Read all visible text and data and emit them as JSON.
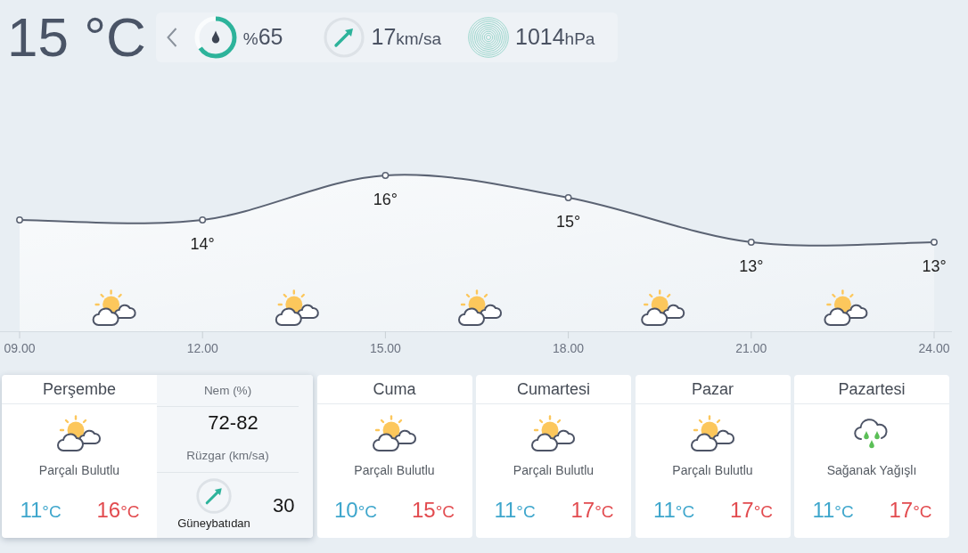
{
  "current": {
    "temperature": "15 °C",
    "humidity": {
      "unit": "%",
      "value": "65",
      "level": 0.65
    },
    "wind": {
      "value": "17",
      "unit": "km/sa"
    },
    "pressure": {
      "value": "1014",
      "unit": "hPa"
    }
  },
  "hourly": {
    "chart_data": {
      "type": "area",
      "categories": [
        "09.00",
        "12.00",
        "15.00",
        "18.00",
        "21.00",
        "24.00"
      ],
      "values": [
        14,
        14,
        16,
        15,
        13,
        13
      ],
      "value_labels": [
        null,
        "14°",
        "16°",
        "15°",
        "13°",
        "13°"
      ]
    },
    "conditions": [
      {
        "kind": "partly_cloudy"
      },
      {
        "kind": "partly_cloudy"
      },
      {
        "kind": "partly_cloudy"
      },
      {
        "kind": "partly_cloudy"
      },
      {
        "kind": "partly_cloudy"
      }
    ]
  },
  "days": [
    {
      "name": "Perşembe",
      "selected": true,
      "kind": "partly_cloudy",
      "condition": "Parçalı Bulutlu",
      "low": {
        "value": "11",
        "unit": "°C"
      },
      "high": {
        "value": "16",
        "unit": "°C"
      },
      "details": {
        "humidity_label": "Nem (%)",
        "humidity": "72-82",
        "wind_label": "Rüzgar (km/sa)",
        "wind_direction": "Güneybatıdan",
        "wind_speed": "30"
      }
    },
    {
      "name": "Cuma",
      "selected": false,
      "kind": "partly_cloudy",
      "condition": "Parçalı Bulutlu",
      "low": {
        "value": "10",
        "unit": "°C"
      },
      "high": {
        "value": "15",
        "unit": "°C"
      }
    },
    {
      "name": "Cumartesi",
      "selected": false,
      "kind": "partly_cloudy",
      "condition": "Parçalı Bulutlu",
      "low": {
        "value": "11",
        "unit": "°C"
      },
      "high": {
        "value": "17",
        "unit": "°C"
      }
    },
    {
      "name": "Pazar",
      "selected": false,
      "kind": "partly_cloudy",
      "condition": "Parçalı Bulutlu",
      "low": {
        "value": "11",
        "unit": "°C"
      },
      "high": {
        "value": "17",
        "unit": "°C"
      }
    },
    {
      "name": "Pazartesi",
      "selected": false,
      "kind": "rain",
      "condition": "Sağanak Yağışlı",
      "low": {
        "value": "11",
        "unit": "°C"
      },
      "high": {
        "value": "17",
        "unit": "°C"
      }
    }
  ]
}
